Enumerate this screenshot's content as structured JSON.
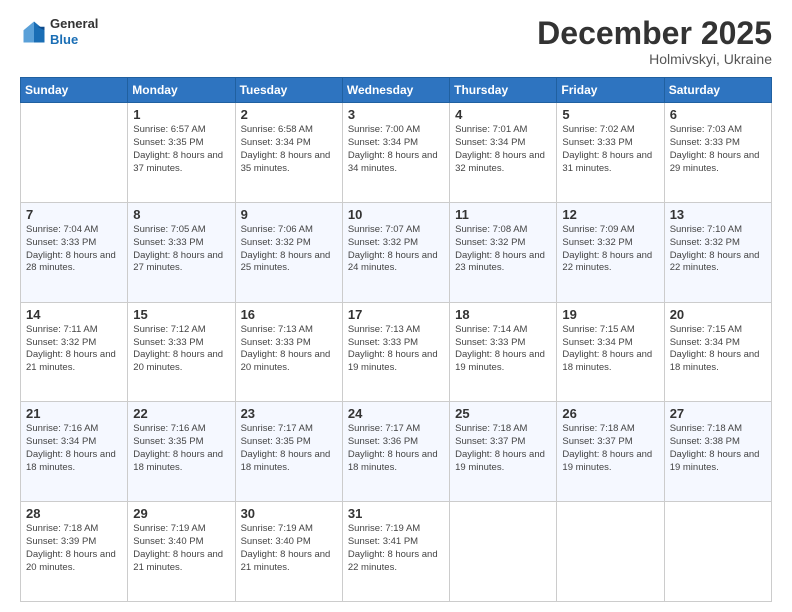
{
  "header": {
    "logo": {
      "line1": "General",
      "line2": "Blue"
    },
    "title": "December 2025",
    "location": "Holmivskyi, Ukraine"
  },
  "weekdays": [
    "Sunday",
    "Monday",
    "Tuesday",
    "Wednesday",
    "Thursday",
    "Friday",
    "Saturday"
  ],
  "weeks": [
    [
      {
        "day": "",
        "sunrise": "",
        "sunset": "",
        "daylight": ""
      },
      {
        "day": "1",
        "sunrise": "Sunrise: 6:57 AM",
        "sunset": "Sunset: 3:35 PM",
        "daylight": "Daylight: 8 hours and 37 minutes."
      },
      {
        "day": "2",
        "sunrise": "Sunrise: 6:58 AM",
        "sunset": "Sunset: 3:34 PM",
        "daylight": "Daylight: 8 hours and 35 minutes."
      },
      {
        "day": "3",
        "sunrise": "Sunrise: 7:00 AM",
        "sunset": "Sunset: 3:34 PM",
        "daylight": "Daylight: 8 hours and 34 minutes."
      },
      {
        "day": "4",
        "sunrise": "Sunrise: 7:01 AM",
        "sunset": "Sunset: 3:34 PM",
        "daylight": "Daylight: 8 hours and 32 minutes."
      },
      {
        "day": "5",
        "sunrise": "Sunrise: 7:02 AM",
        "sunset": "Sunset: 3:33 PM",
        "daylight": "Daylight: 8 hours and 31 minutes."
      },
      {
        "day": "6",
        "sunrise": "Sunrise: 7:03 AM",
        "sunset": "Sunset: 3:33 PM",
        "daylight": "Daylight: 8 hours and 29 minutes."
      }
    ],
    [
      {
        "day": "7",
        "sunrise": "Sunrise: 7:04 AM",
        "sunset": "Sunset: 3:33 PM",
        "daylight": "Daylight: 8 hours and 28 minutes."
      },
      {
        "day": "8",
        "sunrise": "Sunrise: 7:05 AM",
        "sunset": "Sunset: 3:33 PM",
        "daylight": "Daylight: 8 hours and 27 minutes."
      },
      {
        "day": "9",
        "sunrise": "Sunrise: 7:06 AM",
        "sunset": "Sunset: 3:32 PM",
        "daylight": "Daylight: 8 hours and 25 minutes."
      },
      {
        "day": "10",
        "sunrise": "Sunrise: 7:07 AM",
        "sunset": "Sunset: 3:32 PM",
        "daylight": "Daylight: 8 hours and 24 minutes."
      },
      {
        "day": "11",
        "sunrise": "Sunrise: 7:08 AM",
        "sunset": "Sunset: 3:32 PM",
        "daylight": "Daylight: 8 hours and 23 minutes."
      },
      {
        "day": "12",
        "sunrise": "Sunrise: 7:09 AM",
        "sunset": "Sunset: 3:32 PM",
        "daylight": "Daylight: 8 hours and 22 minutes."
      },
      {
        "day": "13",
        "sunrise": "Sunrise: 7:10 AM",
        "sunset": "Sunset: 3:32 PM",
        "daylight": "Daylight: 8 hours and 22 minutes."
      }
    ],
    [
      {
        "day": "14",
        "sunrise": "Sunrise: 7:11 AM",
        "sunset": "Sunset: 3:32 PM",
        "daylight": "Daylight: 8 hours and 21 minutes."
      },
      {
        "day": "15",
        "sunrise": "Sunrise: 7:12 AM",
        "sunset": "Sunset: 3:33 PM",
        "daylight": "Daylight: 8 hours and 20 minutes."
      },
      {
        "day": "16",
        "sunrise": "Sunrise: 7:13 AM",
        "sunset": "Sunset: 3:33 PM",
        "daylight": "Daylight: 8 hours and 20 minutes."
      },
      {
        "day": "17",
        "sunrise": "Sunrise: 7:13 AM",
        "sunset": "Sunset: 3:33 PM",
        "daylight": "Daylight: 8 hours and 19 minutes."
      },
      {
        "day": "18",
        "sunrise": "Sunrise: 7:14 AM",
        "sunset": "Sunset: 3:33 PM",
        "daylight": "Daylight: 8 hours and 19 minutes."
      },
      {
        "day": "19",
        "sunrise": "Sunrise: 7:15 AM",
        "sunset": "Sunset: 3:34 PM",
        "daylight": "Daylight: 8 hours and 18 minutes."
      },
      {
        "day": "20",
        "sunrise": "Sunrise: 7:15 AM",
        "sunset": "Sunset: 3:34 PM",
        "daylight": "Daylight: 8 hours and 18 minutes."
      }
    ],
    [
      {
        "day": "21",
        "sunrise": "Sunrise: 7:16 AM",
        "sunset": "Sunset: 3:34 PM",
        "daylight": "Daylight: 8 hours and 18 minutes."
      },
      {
        "day": "22",
        "sunrise": "Sunrise: 7:16 AM",
        "sunset": "Sunset: 3:35 PM",
        "daylight": "Daylight: 8 hours and 18 minutes."
      },
      {
        "day": "23",
        "sunrise": "Sunrise: 7:17 AM",
        "sunset": "Sunset: 3:35 PM",
        "daylight": "Daylight: 8 hours and 18 minutes."
      },
      {
        "day": "24",
        "sunrise": "Sunrise: 7:17 AM",
        "sunset": "Sunset: 3:36 PM",
        "daylight": "Daylight: 8 hours and 18 minutes."
      },
      {
        "day": "25",
        "sunrise": "Sunrise: 7:18 AM",
        "sunset": "Sunset: 3:37 PM",
        "daylight": "Daylight: 8 hours and 19 minutes."
      },
      {
        "day": "26",
        "sunrise": "Sunrise: 7:18 AM",
        "sunset": "Sunset: 3:37 PM",
        "daylight": "Daylight: 8 hours and 19 minutes."
      },
      {
        "day": "27",
        "sunrise": "Sunrise: 7:18 AM",
        "sunset": "Sunset: 3:38 PM",
        "daylight": "Daylight: 8 hours and 19 minutes."
      }
    ],
    [
      {
        "day": "28",
        "sunrise": "Sunrise: 7:18 AM",
        "sunset": "Sunset: 3:39 PM",
        "daylight": "Daylight: 8 hours and 20 minutes."
      },
      {
        "day": "29",
        "sunrise": "Sunrise: 7:19 AM",
        "sunset": "Sunset: 3:40 PM",
        "daylight": "Daylight: 8 hours and 21 minutes."
      },
      {
        "day": "30",
        "sunrise": "Sunrise: 7:19 AM",
        "sunset": "Sunset: 3:40 PM",
        "daylight": "Daylight: 8 hours and 21 minutes."
      },
      {
        "day": "31",
        "sunrise": "Sunrise: 7:19 AM",
        "sunset": "Sunset: 3:41 PM",
        "daylight": "Daylight: 8 hours and 22 minutes."
      },
      {
        "day": "",
        "sunrise": "",
        "sunset": "",
        "daylight": ""
      },
      {
        "day": "",
        "sunrise": "",
        "sunset": "",
        "daylight": ""
      },
      {
        "day": "",
        "sunrise": "",
        "sunset": "",
        "daylight": ""
      }
    ]
  ]
}
